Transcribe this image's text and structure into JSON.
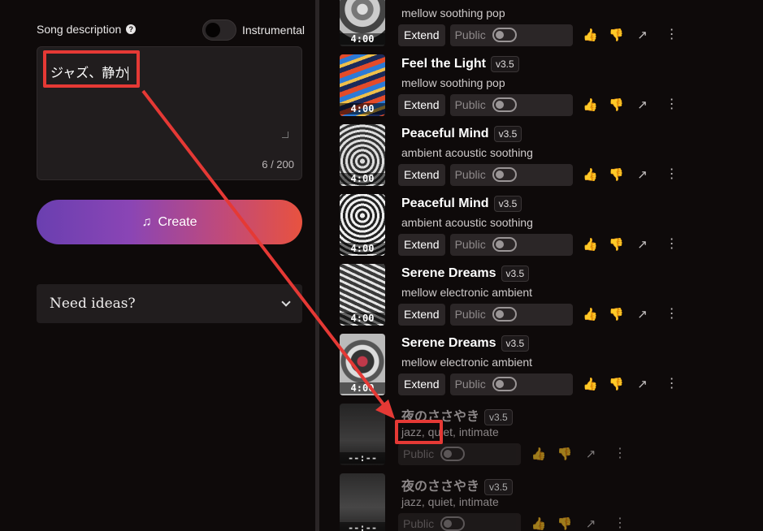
{
  "left": {
    "desc_label": "Song description",
    "instrumental_label": "Instrumental",
    "description_value": "ジャズ、静か",
    "char_count": "6 / 200",
    "create_label": "Create",
    "ideas_label": "Need ideas?"
  },
  "songs": [
    {
      "title": "",
      "style": "mellow soothing pop",
      "version": "",
      "duration": "4:00",
      "extend": "Extend",
      "public": "Public"
    },
    {
      "title": "Feel the Light",
      "style": "mellow soothing pop",
      "version": "v3.5",
      "duration": "4:00",
      "extend": "Extend",
      "public": "Public"
    },
    {
      "title": "Peaceful Mind",
      "style": "ambient acoustic soothing",
      "version": "v3.5",
      "duration": "4:00",
      "extend": "Extend",
      "public": "Public"
    },
    {
      "title": "Peaceful Mind",
      "style": "ambient acoustic soothing",
      "version": "v3.5",
      "duration": "4:00",
      "extend": "Extend",
      "public": "Public"
    },
    {
      "title": "Serene Dreams",
      "style": "mellow electronic ambient",
      "version": "v3.5",
      "duration": "4:00",
      "extend": "Extend",
      "public": "Public"
    },
    {
      "title": "Serene Dreams",
      "style": "mellow electronic ambient",
      "version": "v3.5",
      "duration": "4:00",
      "extend": "Extend",
      "public": "Public"
    },
    {
      "title": "夜のささやき",
      "style": "jazz, quiet, intimate",
      "version": "v3.5",
      "duration": "--:--",
      "public": "Public"
    },
    {
      "title": "夜のささやき",
      "style": "jazz, quiet, intimate",
      "version": "v3.5",
      "duration": "--:--",
      "public": "Public"
    }
  ],
  "colors": {
    "highlight": "#e53935",
    "create_gradient": [
      "#6a3fb0",
      "#e8523f"
    ]
  }
}
